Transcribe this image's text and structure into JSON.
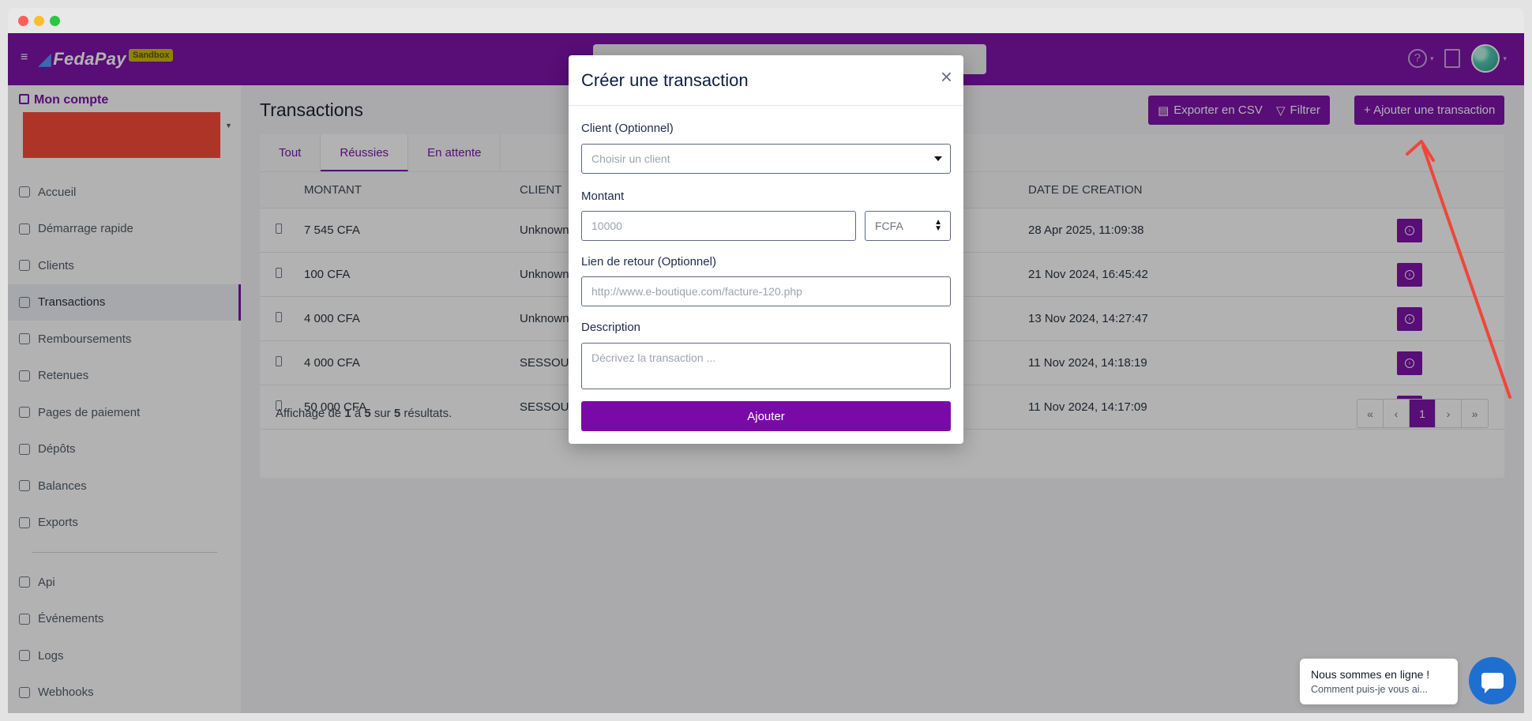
{
  "header": {
    "logo": "FedaPay",
    "env_badge": "Sandbox"
  },
  "sidebar": {
    "account_label": "Mon compte",
    "items": [
      {
        "label": "Accueil",
        "icon": "home-icon"
      },
      {
        "label": "Démarrage rapide",
        "icon": "flag-icon"
      },
      {
        "label": "Clients",
        "icon": "user-circle-icon"
      },
      {
        "label": "Transactions",
        "icon": "money-icon",
        "active": true
      },
      {
        "label": "Remboursements",
        "icon": "history-icon"
      },
      {
        "label": "Retenues",
        "icon": "info-icon"
      },
      {
        "label": "Pages de paiement",
        "icon": "file-icon"
      },
      {
        "label": "Dépôts",
        "icon": "external-link-icon"
      },
      {
        "label": "Balances",
        "icon": "scale-icon"
      },
      {
        "label": "Exports",
        "icon": "download-icon"
      }
    ],
    "dev_items": [
      {
        "label": "Api",
        "icon": "terminal-icon"
      },
      {
        "label": "Événements",
        "icon": "rss-icon"
      },
      {
        "label": "Logs",
        "icon": "file-icon"
      },
      {
        "label": "Webhooks",
        "icon": "link-icon"
      }
    ]
  },
  "main": {
    "title": "Transactions",
    "buttons": {
      "export": "Exporter en CSV",
      "filter": "Filtrer",
      "add": "+ Ajouter une transaction"
    },
    "tabs": [
      "Tout",
      "Réussies",
      "En attente"
    ],
    "active_tab": "Réussies",
    "columns": {
      "amount": "MONTANT",
      "client": "CLIENT",
      "date": "DATE DE CREATION"
    },
    "rows": [
      {
        "amount": "7 545 CFA",
        "client": "Unknown",
        "date": "28 Apr 2025, 11:09:38"
      },
      {
        "amount": "100 CFA",
        "client": "Unknown",
        "date": "21 Nov 2024, 16:45:42"
      },
      {
        "amount": "4 000 CFA",
        "client": "Unknown",
        "date": "13 Nov 2024, 14:27:47"
      },
      {
        "amount": "4 000 CFA",
        "client": "SESSOU",
        "date": "11 Nov 2024, 14:18:19"
      },
      {
        "amount": "50 000 CFA",
        "client": "SESSOU",
        "date": "11 Nov 2024, 14:17:09"
      }
    ],
    "footer": {
      "prefix": "Affichage de",
      "from": "1",
      "to_word": "à",
      "to": "5",
      "of_word": "sur",
      "total": "5",
      "suffix": "résultats."
    },
    "pager": [
      "«",
      "‹",
      "1",
      "›",
      "»"
    ]
  },
  "modal": {
    "title": "Créer une transaction",
    "close": "×",
    "client_label": "Client (Optionnel)",
    "client_placeholder": "Choisir un client",
    "amount_label": "Montant",
    "amount_placeholder": "10000",
    "currency": "FCFA",
    "return_label": "Lien de retour (Optionnel)",
    "return_placeholder": "http://www.e-boutique.com/facture-120.php",
    "description_label": "Description",
    "description_placeholder": "Décrivez la transaction ...",
    "submit": "Ajouter"
  },
  "chat": {
    "title": "Nous sommes en ligne !",
    "subtitle": "Comment puis-je vous ai..."
  },
  "colors": {
    "brand": "#7a0aa8",
    "annotation": "#f0463a",
    "chat": "#1f6fd1"
  }
}
